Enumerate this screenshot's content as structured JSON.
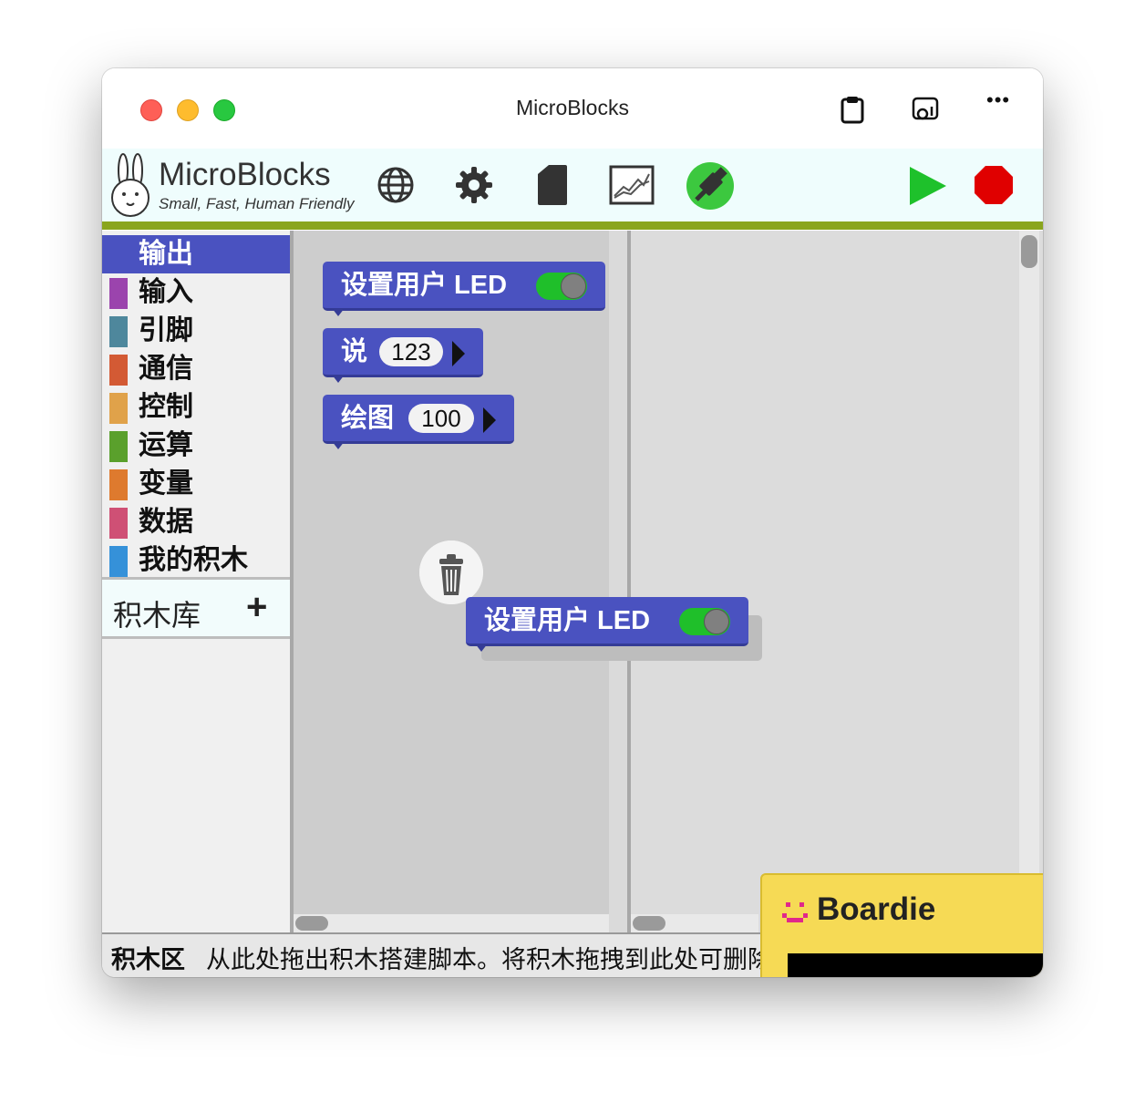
{
  "window": {
    "title": "MicroBlocks"
  },
  "titlebar_icons": [
    "clipboard-icon",
    "screen-share-icon",
    "more-icon"
  ],
  "titlebar_more_glyph": "•••",
  "logo": {
    "name": "MicroBlocks",
    "tagline": "Small, Fast, Human Friendly"
  },
  "toolbar_icons": [
    "globe-icon",
    "gear-icon",
    "file-icon",
    "graph-icon",
    "usb-connect-icon",
    "start-icon",
    "stop-icon"
  ],
  "categories": [
    {
      "label": "输出",
      "color": "#4a52c0",
      "selected": true
    },
    {
      "label": "输入",
      "color": "#9b44ad",
      "selected": false
    },
    {
      "label": "引脚",
      "color": "#4e879c",
      "selected": false
    },
    {
      "label": "通信",
      "color": "#d35a34",
      "selected": false
    },
    {
      "label": "控制",
      "color": "#e0a24a",
      "selected": false
    },
    {
      "label": "运算",
      "color": "#5aa02c",
      "selected": false
    },
    {
      "label": "变量",
      "color": "#de7a2e",
      "selected": false
    },
    {
      "label": "数据",
      "color": "#cf5075",
      "selected": false
    },
    {
      "label": "我的积木",
      "color": "#3591d9",
      "selected": false
    }
  ],
  "library": {
    "label": "积木库",
    "add": "+"
  },
  "palette_blocks": {
    "set_led": {
      "label": "设置用户 LED",
      "toggle_on": true
    },
    "say": {
      "label": "说",
      "value": "123"
    },
    "graph": {
      "label": "绘图",
      "value": "100"
    }
  },
  "dragged_block": {
    "label": "设置用户 LED",
    "toggle_on": true
  },
  "status": {
    "label": "积木区",
    "text": "从此处拖出积木搭建脚本。将积木拖拽到此处可删除。"
  },
  "boardie": {
    "title": "Boardie"
  },
  "colors": {
    "accent": "#4a52c0",
    "toolbar_bg": "#effdfd",
    "green_bar": "#8aa51d",
    "start": "#1ec12b",
    "stop": "#e00000",
    "boardie_bg": "#f6da55"
  }
}
